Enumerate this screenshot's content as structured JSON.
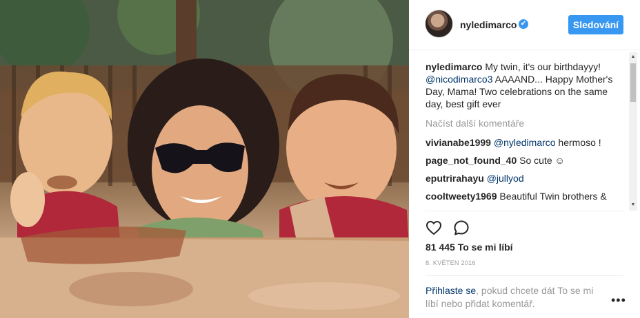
{
  "post": {
    "photo_alt": "",
    "author": {
      "username": "nyledimarco",
      "verified_badge": "✔",
      "follow_label": "Sledování"
    },
    "caption": {
      "username": "nyledimarco",
      "text_1": " My twin, it's our birthdayyy! ",
      "mention": "@nicodimarco3",
      "text_2": " AAAAND... Happy Mother's Day, Mama! Two celebrations on the same day, best gift ever"
    },
    "load_more_label": "Načíst další komentáře",
    "comments": [
      {
        "username": "vivianabe1999",
        "mention": "@nyledimarco",
        "text": " hermoso !"
      },
      {
        "username": "page_not_found_40",
        "mention": "",
        "text": " So cute ☺"
      },
      {
        "username": "eputrirahayu",
        "mention": "@jullyod",
        "text": ""
      },
      {
        "username": "cooltweety1969",
        "mention": "",
        "text": " Beautiful Twin brothers &"
      }
    ],
    "likes_label": "81 445 To se mi líbí",
    "date": "8. KVĚTEN 2016",
    "login_prompt": {
      "link": "Přihlaste se",
      "text": ", pokud chcete dát To se mi líbí nebo přidat komentář."
    },
    "more_symbol": "•••"
  },
  "icons": {
    "like": "heart-outline-icon",
    "comment": "speech-bubble-icon",
    "more": "more-options-icon",
    "verified": "verified-badge-icon"
  },
  "colors": {
    "accent": "#3897f0",
    "mention": "#003569",
    "muted": "#999999",
    "text": "#262626"
  }
}
